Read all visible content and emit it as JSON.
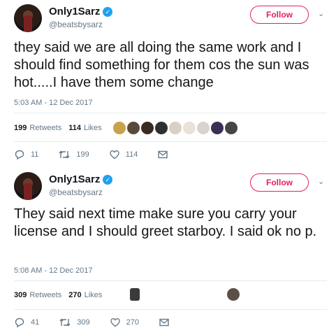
{
  "tweets": [
    {
      "name": "Only1Sarz",
      "handle": "@beatsbysarz",
      "follow_label": "Follow",
      "text": "they said we are all doing the same work and I should find something for them cos the sun was hot.....I have them some change",
      "timestamp": "5:03 AM - 12 Dec 2017",
      "retweets": "199",
      "retweets_label": "Retweets",
      "likes": "114",
      "likes_label": "Likes",
      "reply_count": "11",
      "retweet_count": "199",
      "like_count": "114"
    },
    {
      "name": "Only1Sarz",
      "handle": "@beatsbysarz",
      "follow_label": "Follow",
      "text": "They said next time make sure you carry your license and I should greet starboy. I said ok no p.",
      "timestamp": "5:08 AM - 12 Dec 2017",
      "retweets": "309",
      "retweets_label": "Retweets",
      "likes": "270",
      "likes_label": "Likes",
      "reply_count": "41",
      "retweet_count": "309",
      "like_count": "270"
    }
  ],
  "colors": {
    "follow": "#e0245e",
    "verified": "#1da1f2",
    "muted": "#657786"
  }
}
